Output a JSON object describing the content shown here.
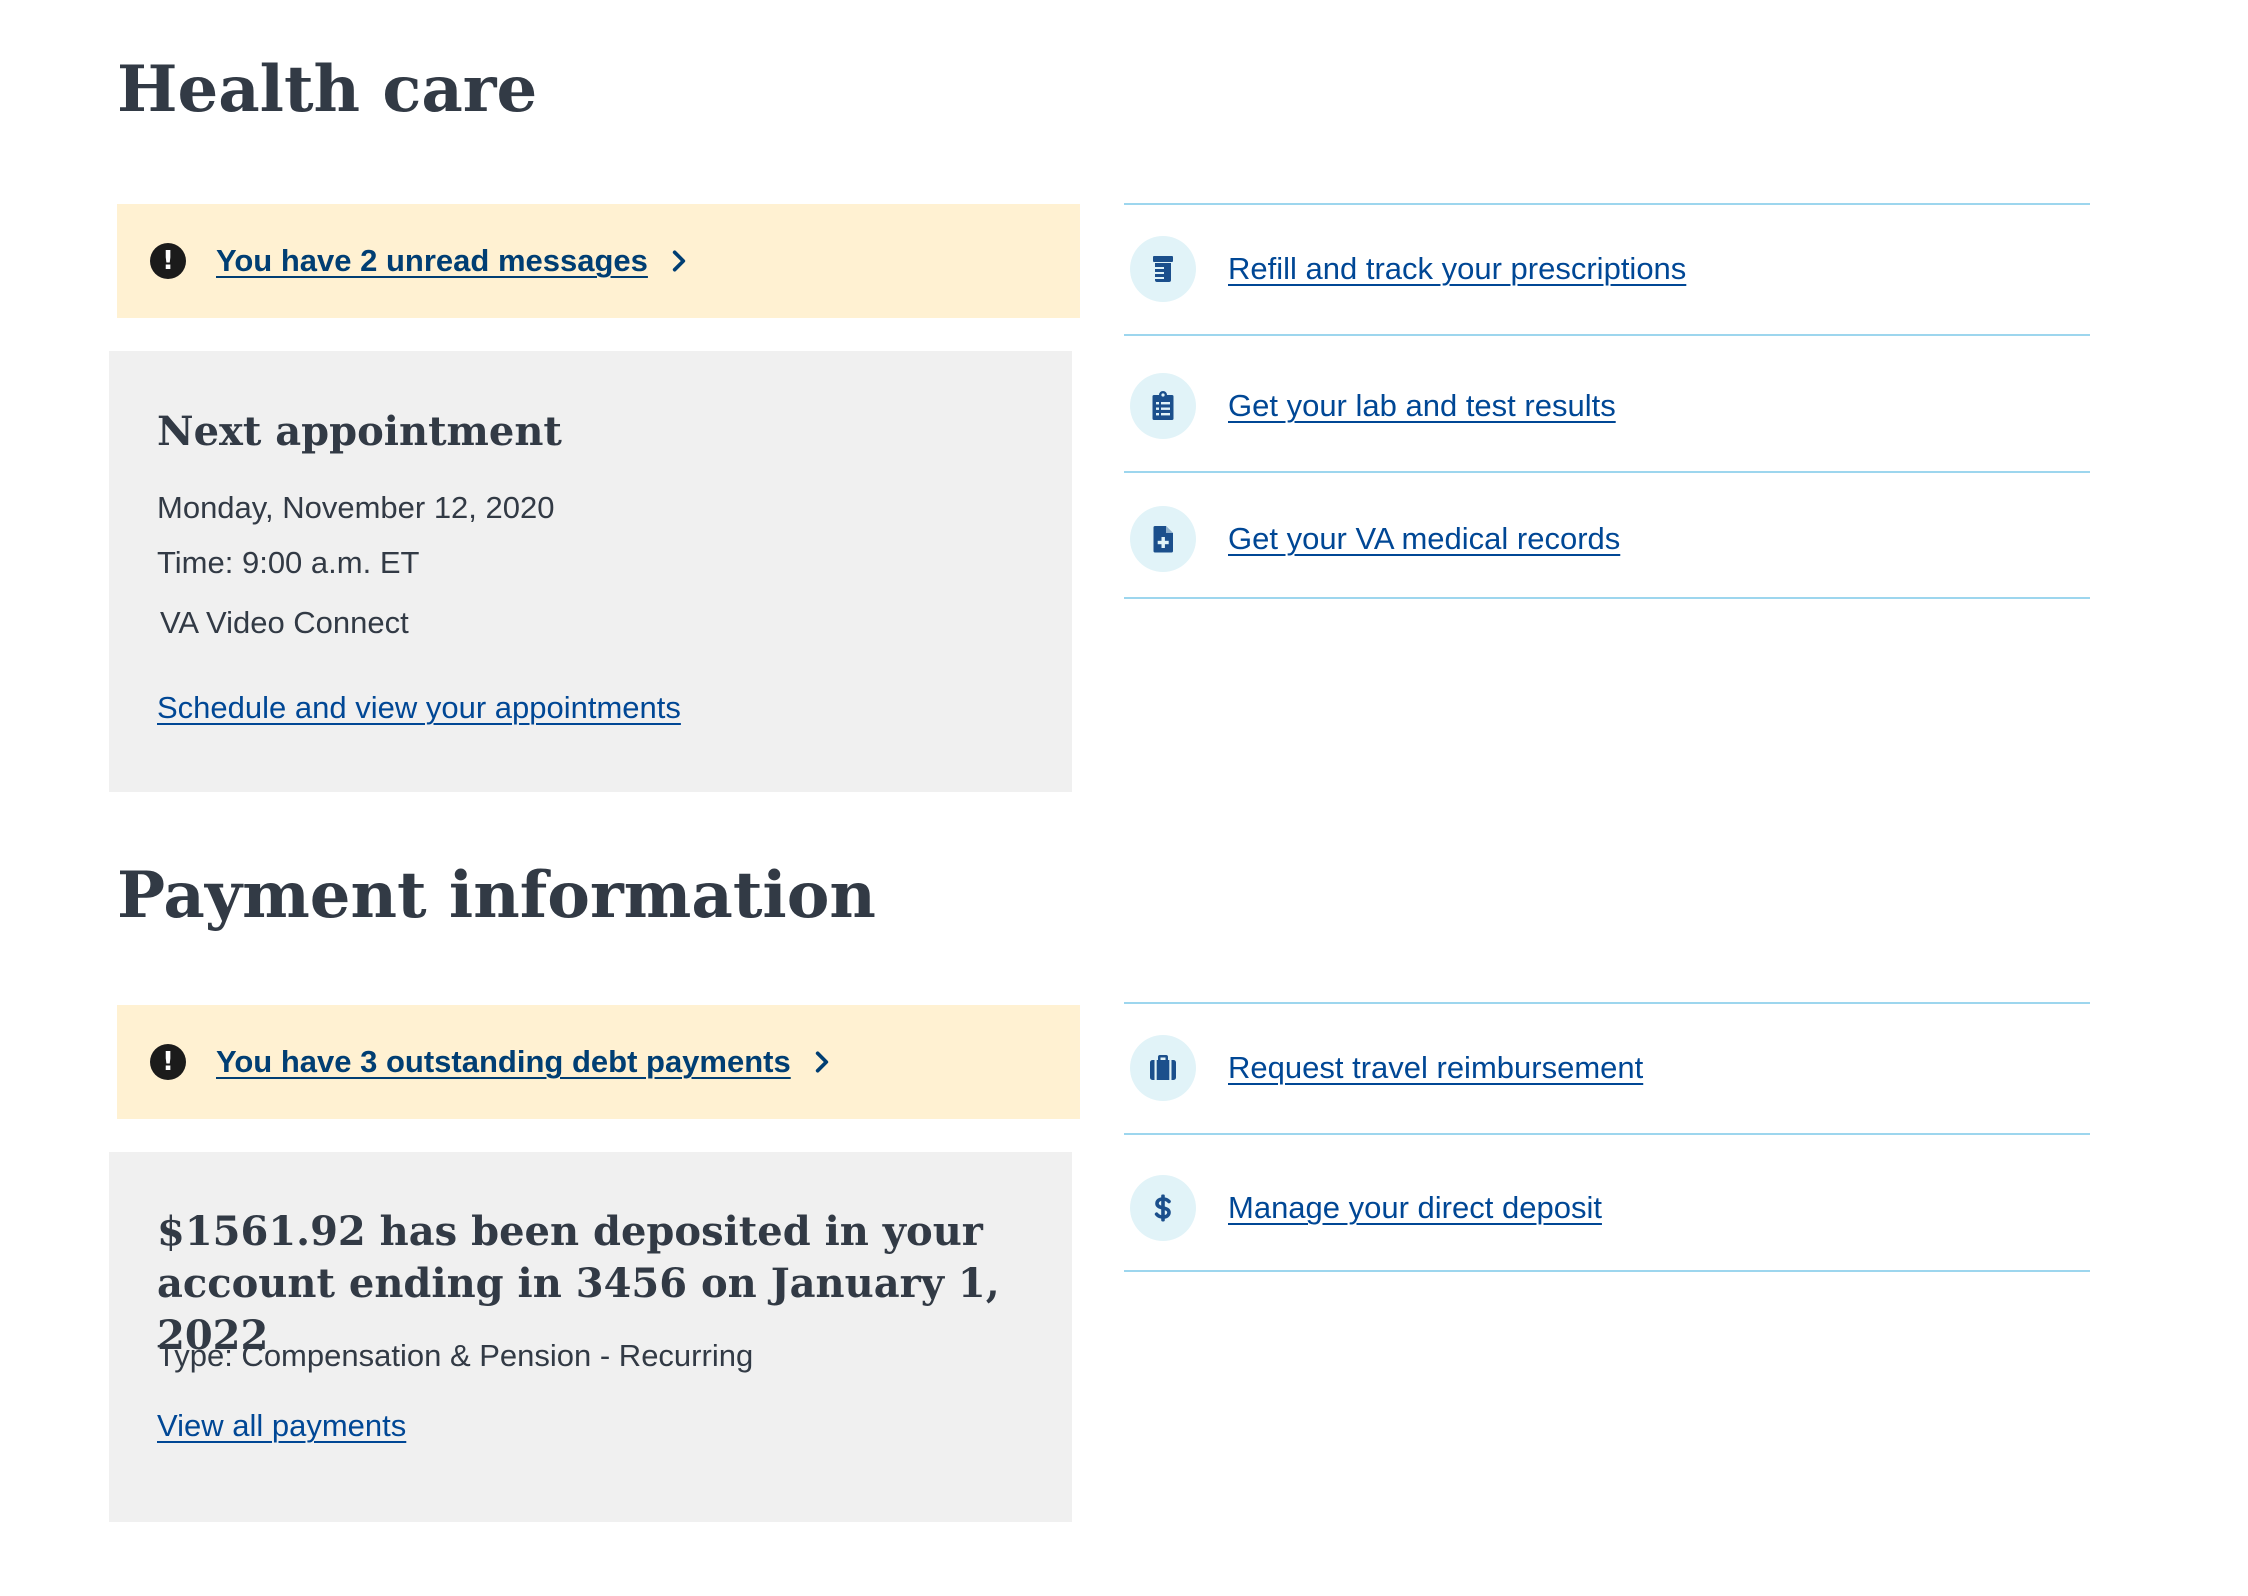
{
  "health_care": {
    "title": "Health care",
    "alert": {
      "icon": "exclamation-circle-icon",
      "link_text": "You have 2 unread messages",
      "background": "#fff1d2"
    },
    "appointment": {
      "heading": "Next appointment",
      "date": "Monday, November 12, 2020",
      "time": "Time: 9:00 a.m. ET",
      "location": "VA Video Connect",
      "link_text": "Schedule and view your appointments"
    },
    "links": [
      {
        "icon": "prescription-bottle-icon",
        "label": "Refill and track your prescriptions"
      },
      {
        "icon": "clipboard-list-icon",
        "label": "Get your lab and test results"
      },
      {
        "icon": "file-medical-icon",
        "label": "Get your VA medical records"
      }
    ]
  },
  "payment_information": {
    "title": "Payment information",
    "alert": {
      "icon": "exclamation-circle-icon",
      "link_text": "You have 3 outstanding debt payments"
    },
    "deposit": {
      "heading": "$1561.92 has been deposited in your account ending in 3456 on January 1, 2022",
      "type": "Type: Compensation & Pension - Recurring",
      "link_text": "View all payments"
    },
    "links": [
      {
        "icon": "suitcase-icon",
        "label": "Request travel reimbursement"
      },
      {
        "icon": "dollar-sign-icon",
        "label": "Manage your direct deposit"
      }
    ]
  },
  "colors": {
    "link": "#004795",
    "alert_link": "#003e73",
    "heading": "#323a45",
    "card_background": "#f0f0f0",
    "divider": "#9dd6ee",
    "icon_circle": "#e1f3f8",
    "icon": "#1b4f8c"
  }
}
